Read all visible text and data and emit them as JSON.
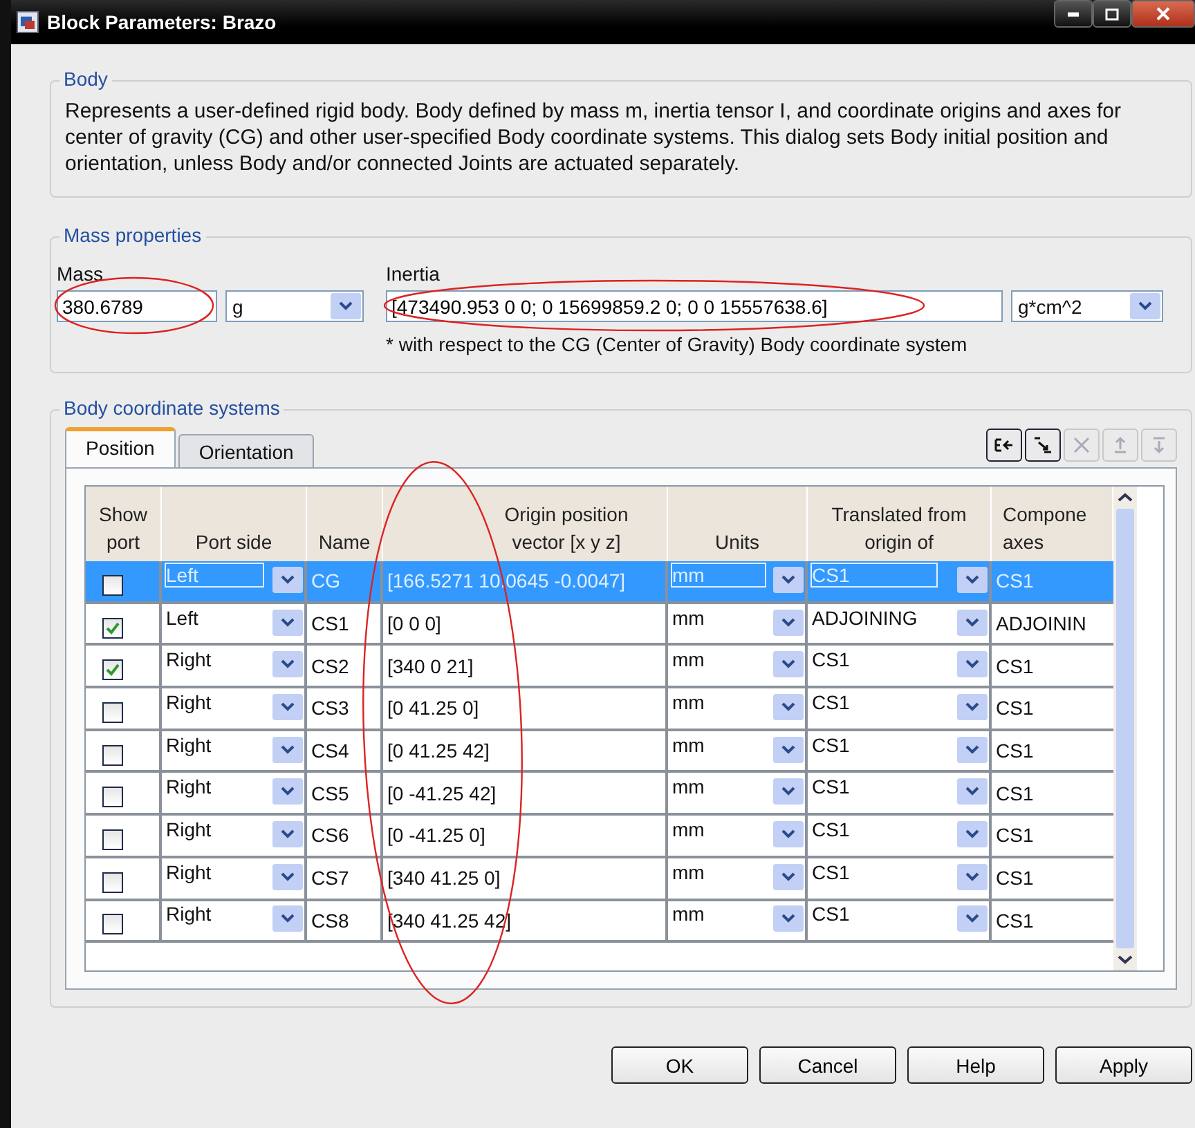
{
  "window": {
    "title": "Block Parameters: Brazo"
  },
  "body_group": {
    "legend": "Body",
    "description": "Represents a user-defined rigid body. Body defined by mass m, inertia tensor I, and coordinate origins and axes for center of gravity (CG) and other user-specified Body coordinate systems. This dialog sets Body initial position and orientation, unless Body and/or connected Joints are actuated separately."
  },
  "mass_properties": {
    "legend": "Mass properties",
    "mass_label": "Mass",
    "mass_value": "380.6789",
    "mass_unit": "g",
    "inertia_label": "Inertia",
    "inertia_value": "[473490.953 0 0; 0 15699859.2 0; 0 0 15557638.6]",
    "inertia_unit": "g*cm^2",
    "note": "* with respect to the CG (Center of Gravity) Body coordinate system"
  },
  "coordinate_systems": {
    "legend": "Body coordinate systems",
    "tabs": [
      {
        "label": "Position",
        "selected": true
      },
      {
        "label": "Orientation",
        "selected": false
      }
    ],
    "toolbar": [
      {
        "kind": "add",
        "disabled": false
      },
      {
        "kind": "insert",
        "disabled": false
      },
      {
        "kind": "delete",
        "disabled": true
      },
      {
        "kind": "up",
        "disabled": true
      },
      {
        "kind": "down",
        "disabled": true
      }
    ],
    "columns": [
      [
        "Show",
        "port"
      ],
      [
        "Port side"
      ],
      [
        "Name"
      ],
      [
        "Origin position",
        "vector [x y z]"
      ],
      [
        "Units"
      ],
      [
        "Translated from",
        "origin of"
      ],
      [
        "Compone",
        "axes"
      ]
    ],
    "rows": [
      {
        "show_port": false,
        "selected": true,
        "port_side": "Left",
        "name": "CG",
        "origin": "[166.5271 10.0645 -0.0047]",
        "units": "mm",
        "translated_from": "CS1",
        "components_axes": "CS1"
      },
      {
        "show_port": true,
        "selected": false,
        "port_side": "Left",
        "name": "CS1",
        "origin": "[0 0 0]",
        "units": "mm",
        "translated_from": "ADJOINING",
        "components_axes": "ADJOININ"
      },
      {
        "show_port": true,
        "selected": false,
        "port_side": "Right",
        "name": "CS2",
        "origin": "[340 0 21]",
        "units": "mm",
        "translated_from": "CS1",
        "components_axes": "CS1"
      },
      {
        "show_port": false,
        "selected": false,
        "port_side": "Right",
        "name": "CS3",
        "origin": "[0 41.25 0]",
        "units": "mm",
        "translated_from": "CS1",
        "components_axes": "CS1"
      },
      {
        "show_port": false,
        "selected": false,
        "port_side": "Right",
        "name": "CS4",
        "origin": "[0 41.25 42]",
        "units": "mm",
        "translated_from": "CS1",
        "components_axes": "CS1"
      },
      {
        "show_port": false,
        "selected": false,
        "port_side": "Right",
        "name": "CS5",
        "origin": "[0 -41.25 42]",
        "units": "mm",
        "translated_from": "CS1",
        "components_axes": "CS1"
      },
      {
        "show_port": false,
        "selected": false,
        "port_side": "Right",
        "name": "CS6",
        "origin": "[0 -41.25 0]",
        "units": "mm",
        "translated_from": "CS1",
        "components_axes": "CS1"
      },
      {
        "show_port": false,
        "selected": false,
        "port_side": "Right",
        "name": "CS7",
        "origin": "[340 41.25 0]",
        "units": "mm",
        "translated_from": "CS1",
        "components_axes": "CS1"
      },
      {
        "show_port": false,
        "selected": false,
        "port_side": "Right",
        "name": "CS8",
        "origin": "[340 41.25 42]",
        "units": "mm",
        "translated_from": "CS1",
        "components_axes": "CS1"
      }
    ]
  },
  "buttons": [
    "OK",
    "Cancel",
    "Help",
    "Apply"
  ]
}
